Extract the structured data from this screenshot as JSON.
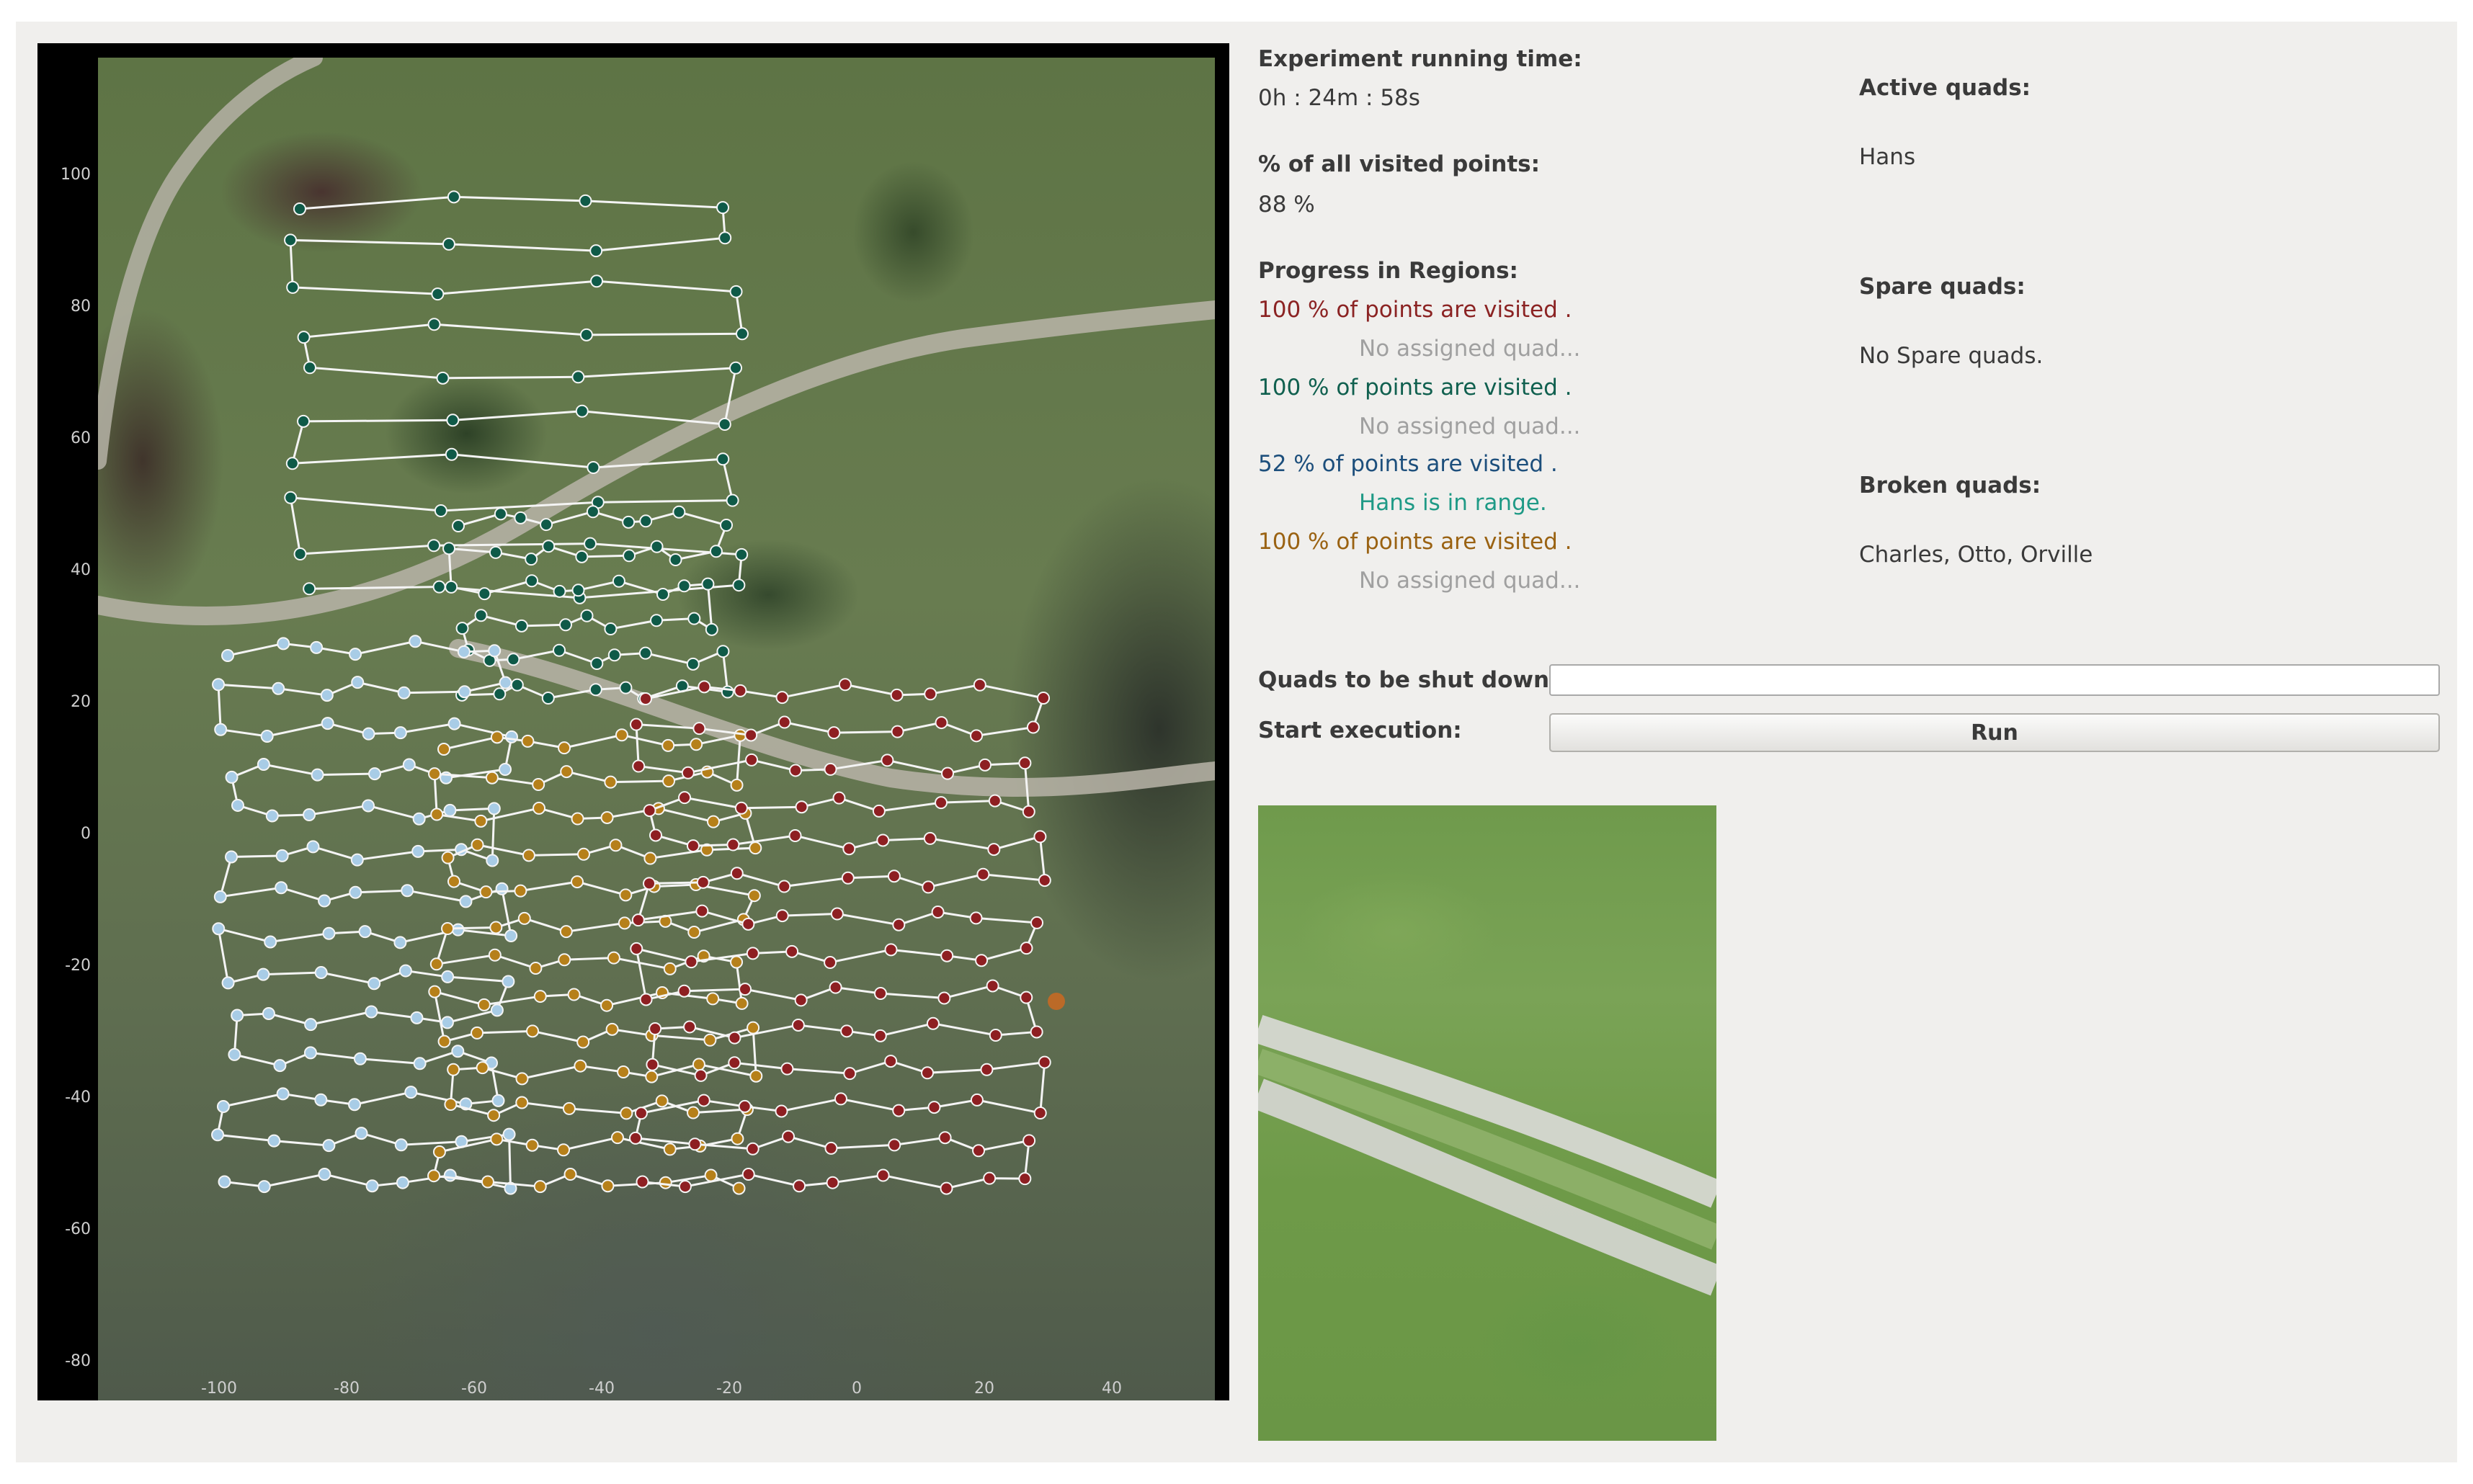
{
  "plot": {
    "x_ticks": [
      "-100",
      "-80",
      "-60",
      "-40",
      "-20",
      "0",
      "20",
      "40"
    ],
    "y_ticks": [
      "100",
      "80",
      "60",
      "40",
      "20",
      "0",
      "-20",
      "-40",
      "-60",
      "-80"
    ],
    "region_colors": {
      "red": "#8e1f22",
      "teal": "#0f5a48",
      "light_blue": "#a8cce6",
      "orange": "#b6801a"
    }
  },
  "status": {
    "running_time_label": "Experiment running time:",
    "running_time_value": "0h : 24m : 58s",
    "visited_label": "% of all visited points:",
    "visited_value": "88 %",
    "progress_label": "Progress in Regions:",
    "regions": [
      {
        "text": "100 % of points are visited .",
        "sub": "No assigned quad...",
        "color": "#8b2323",
        "sub_color": "#a0a0a0"
      },
      {
        "text": "100 % of points are visited .",
        "sub": "No assigned quad...",
        "color": "#10604f",
        "sub_color": "#a0a0a0"
      },
      {
        "text": "52 % of points are visited .",
        "sub": "Hans is in range.",
        "color": "#1d4f7c",
        "sub_color": "#1f9a86"
      },
      {
        "text": "100 % of points are visited .",
        "sub": "No assigned quad...",
        "color": "#9a6212",
        "sub_color": "#a0a0a0"
      }
    ]
  },
  "quads": {
    "active_label": "Active quads:",
    "active_value": "Hans",
    "spare_label": "Spare quads:",
    "spare_value": "No Spare quads.",
    "broken_label": "Broken quads:",
    "broken_value": "Charles, Otto, Orville"
  },
  "controls": {
    "shutdown_label": "Quads to be shut down:",
    "shutdown_value": "",
    "start_label": "Start execution:",
    "run_label": "Run"
  }
}
